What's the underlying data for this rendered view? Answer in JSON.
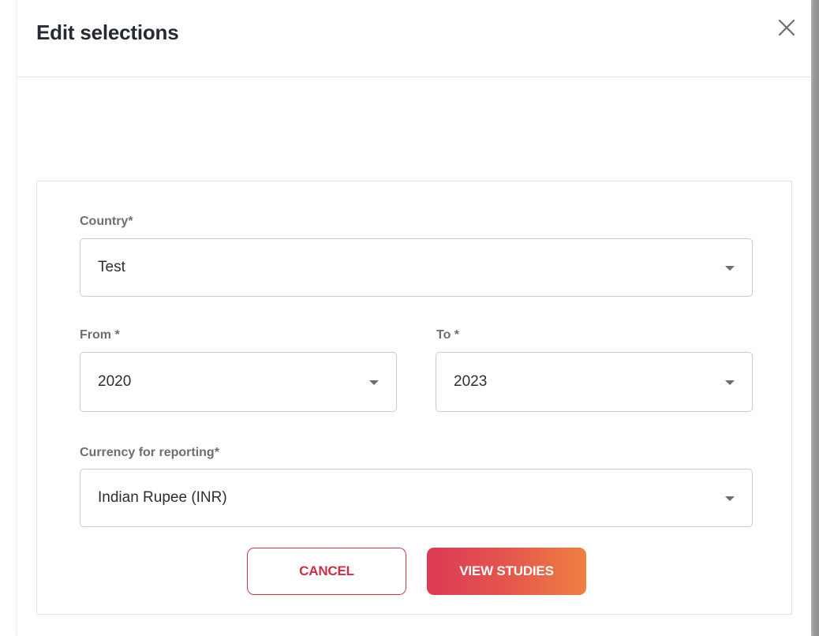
{
  "dialog": {
    "title": "Edit selections",
    "close_icon": "close-icon"
  },
  "form": {
    "country": {
      "label": "Country*",
      "value": "Test"
    },
    "from": {
      "label": "From *",
      "value": "2020"
    },
    "to": {
      "label": "To *",
      "value": "2023"
    },
    "currency": {
      "label": "Currency for reporting*",
      "value": "Indian Rupee (INR)"
    },
    "dropdown_icon": "caret-down-icon"
  },
  "actions": {
    "cancel_label": "CANCEL",
    "view_label": "VIEW STUDIES"
  },
  "colors": {
    "title_text": "#262a33",
    "label_text": "#6b6e75",
    "accent_red": "#cc2f45",
    "gradient_start": "#dc3a55",
    "gradient_end": "#ef8040"
  }
}
